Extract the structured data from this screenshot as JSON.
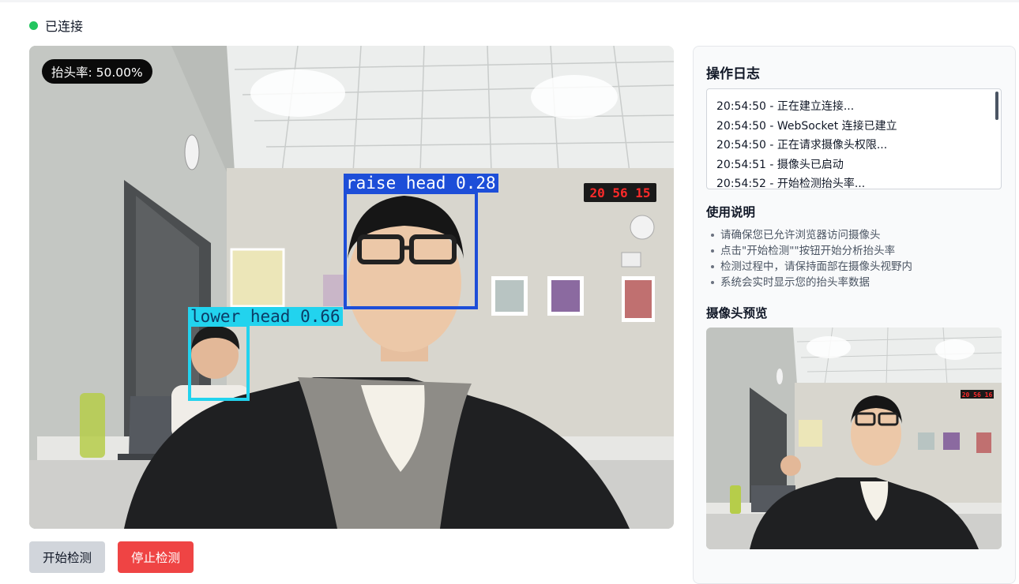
{
  "status": {
    "text": "已连接",
    "color": "#22c55e"
  },
  "video": {
    "rate_badge": "抬头率: 50.00%",
    "clock_display": "20 56 15",
    "detections": [
      {
        "label": "raise head 0.28",
        "color": "#1d4ed8"
      },
      {
        "label": "lower head 0.66",
        "color": "#22d3ee"
      }
    ]
  },
  "buttons": {
    "start": "开始检测",
    "stop": "停止检测"
  },
  "panel": {
    "log_title": "操作日志",
    "logs": [
      "20:54:50 - 正在建立连接...",
      "20:54:50 - WebSocket 连接已建立",
      "20:54:50 - 正在请求摄像头权限...",
      "20:54:51 - 摄像头已启动",
      "20:54:52 - 开始检测抬头率..."
    ],
    "guide_title": "使用说明",
    "guide": [
      "请确保您已允许浏览器访问摄像头",
      "点击\"开始检测\"\"按钮开始分析抬头率",
      "检测过程中，请保持面部在摄像头视野内",
      "系统会实时显示您的抬头率数据"
    ],
    "preview_title": "摄像头预览",
    "preview_clock": "20 56 16"
  }
}
